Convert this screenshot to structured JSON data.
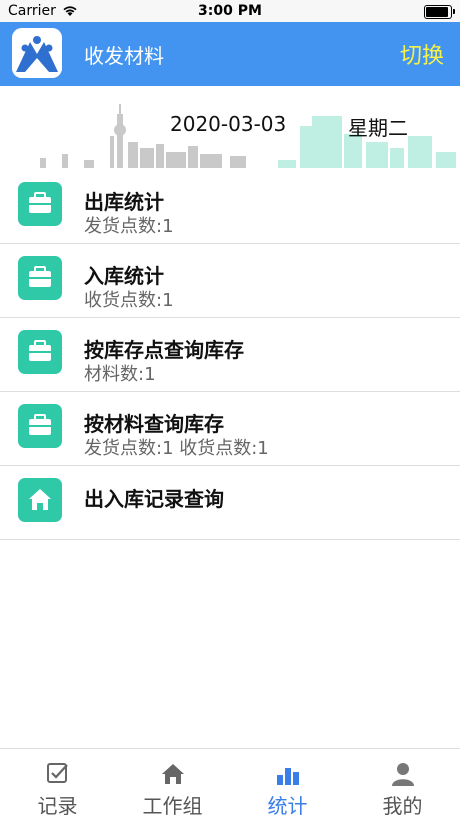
{
  "status_bar": {
    "carrier": "Carrier",
    "time": "3:00 PM"
  },
  "header": {
    "title": "收发材料",
    "switch_label": "切换",
    "brand_color": "#4294f0",
    "switch_color": "#f6f24a"
  },
  "banner": {
    "date": "2020-03-03",
    "weekday": "星期二"
  },
  "menu": [
    {
      "title": "出库统计",
      "subtitle": "发货点数:1",
      "icon": "briefcase-icon"
    },
    {
      "title": "入库统计",
      "subtitle": "收货点数:1",
      "icon": "briefcase-icon"
    },
    {
      "title": "按库存点查询库存",
      "subtitle": "材料数:1",
      "icon": "briefcase-icon"
    },
    {
      "title": "按材料查询库存",
      "subtitle": "发货点数:1 收货点数:1",
      "icon": "briefcase-icon"
    },
    {
      "title": "出入库记录查询",
      "subtitle": "",
      "icon": "home-icon"
    }
  ],
  "accent_color": "#2fc9a8",
  "tabs": [
    {
      "label": "记录",
      "icon": "checkbox-icon",
      "active": false
    },
    {
      "label": "工作组",
      "icon": "home-icon",
      "active": false
    },
    {
      "label": "统计",
      "icon": "bar-chart-icon",
      "active": true
    },
    {
      "label": "我的",
      "icon": "person-icon",
      "active": false
    }
  ]
}
